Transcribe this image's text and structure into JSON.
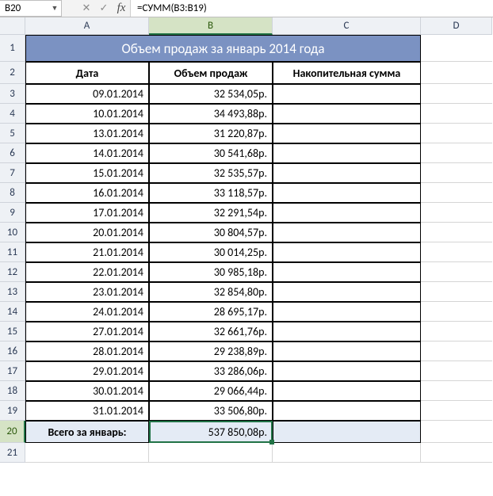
{
  "name_box": "B20",
  "formula": "=СУММ(B3:B19)",
  "columns": [
    "A",
    "B",
    "C",
    "D"
  ],
  "active_col": "B",
  "active_row": 20,
  "row_headers_start": 1,
  "row_headers_end": 21,
  "table": {
    "title": "Объем продаж за январь 2014 года",
    "headers": {
      "date": "Дата",
      "amount": "Объем продаж",
      "cumulative": "Накопительная сумма"
    },
    "rows": [
      {
        "date": "09.01.2014",
        "amount": "32 534,05р.",
        "cumulative": ""
      },
      {
        "date": "10.01.2014",
        "amount": "34 493,88р.",
        "cumulative": ""
      },
      {
        "date": "13.01.2014",
        "amount": "31 220,87р.",
        "cumulative": ""
      },
      {
        "date": "14.01.2014",
        "amount": "30 541,68р.",
        "cumulative": ""
      },
      {
        "date": "15.01.2014",
        "amount": "32 535,57р.",
        "cumulative": ""
      },
      {
        "date": "16.01.2014",
        "amount": "33 118,57р.",
        "cumulative": ""
      },
      {
        "date": "17.01.2014",
        "amount": "32 291,54р.",
        "cumulative": ""
      },
      {
        "date": "20.01.2014",
        "amount": "30 804,57р.",
        "cumulative": ""
      },
      {
        "date": "21.01.2014",
        "amount": "30 014,25р.",
        "cumulative": ""
      },
      {
        "date": "22.01.2014",
        "amount": "30 985,18р.",
        "cumulative": ""
      },
      {
        "date": "23.01.2014",
        "amount": "32 854,80р.",
        "cumulative": ""
      },
      {
        "date": "24.01.2014",
        "amount": "28 695,17р.",
        "cumulative": ""
      },
      {
        "date": "27.01.2014",
        "amount": "32 661,76р.",
        "cumulative": ""
      },
      {
        "date": "28.01.2014",
        "amount": "29 238,89р.",
        "cumulative": ""
      },
      {
        "date": "29.01.2014",
        "amount": "33 286,06р.",
        "cumulative": ""
      },
      {
        "date": "30.01.2014",
        "amount": "29 066,44р.",
        "cumulative": ""
      },
      {
        "date": "31.01.2014",
        "amount": "33 506,80р.",
        "cumulative": ""
      }
    ],
    "total": {
      "label": "Всего за январь:",
      "amount": "537 850,08р.",
      "cumulative": ""
    }
  },
  "icons": {
    "cancel": "✕",
    "enter": "✓",
    "fx": "fx",
    "dropdown": "▼"
  }
}
